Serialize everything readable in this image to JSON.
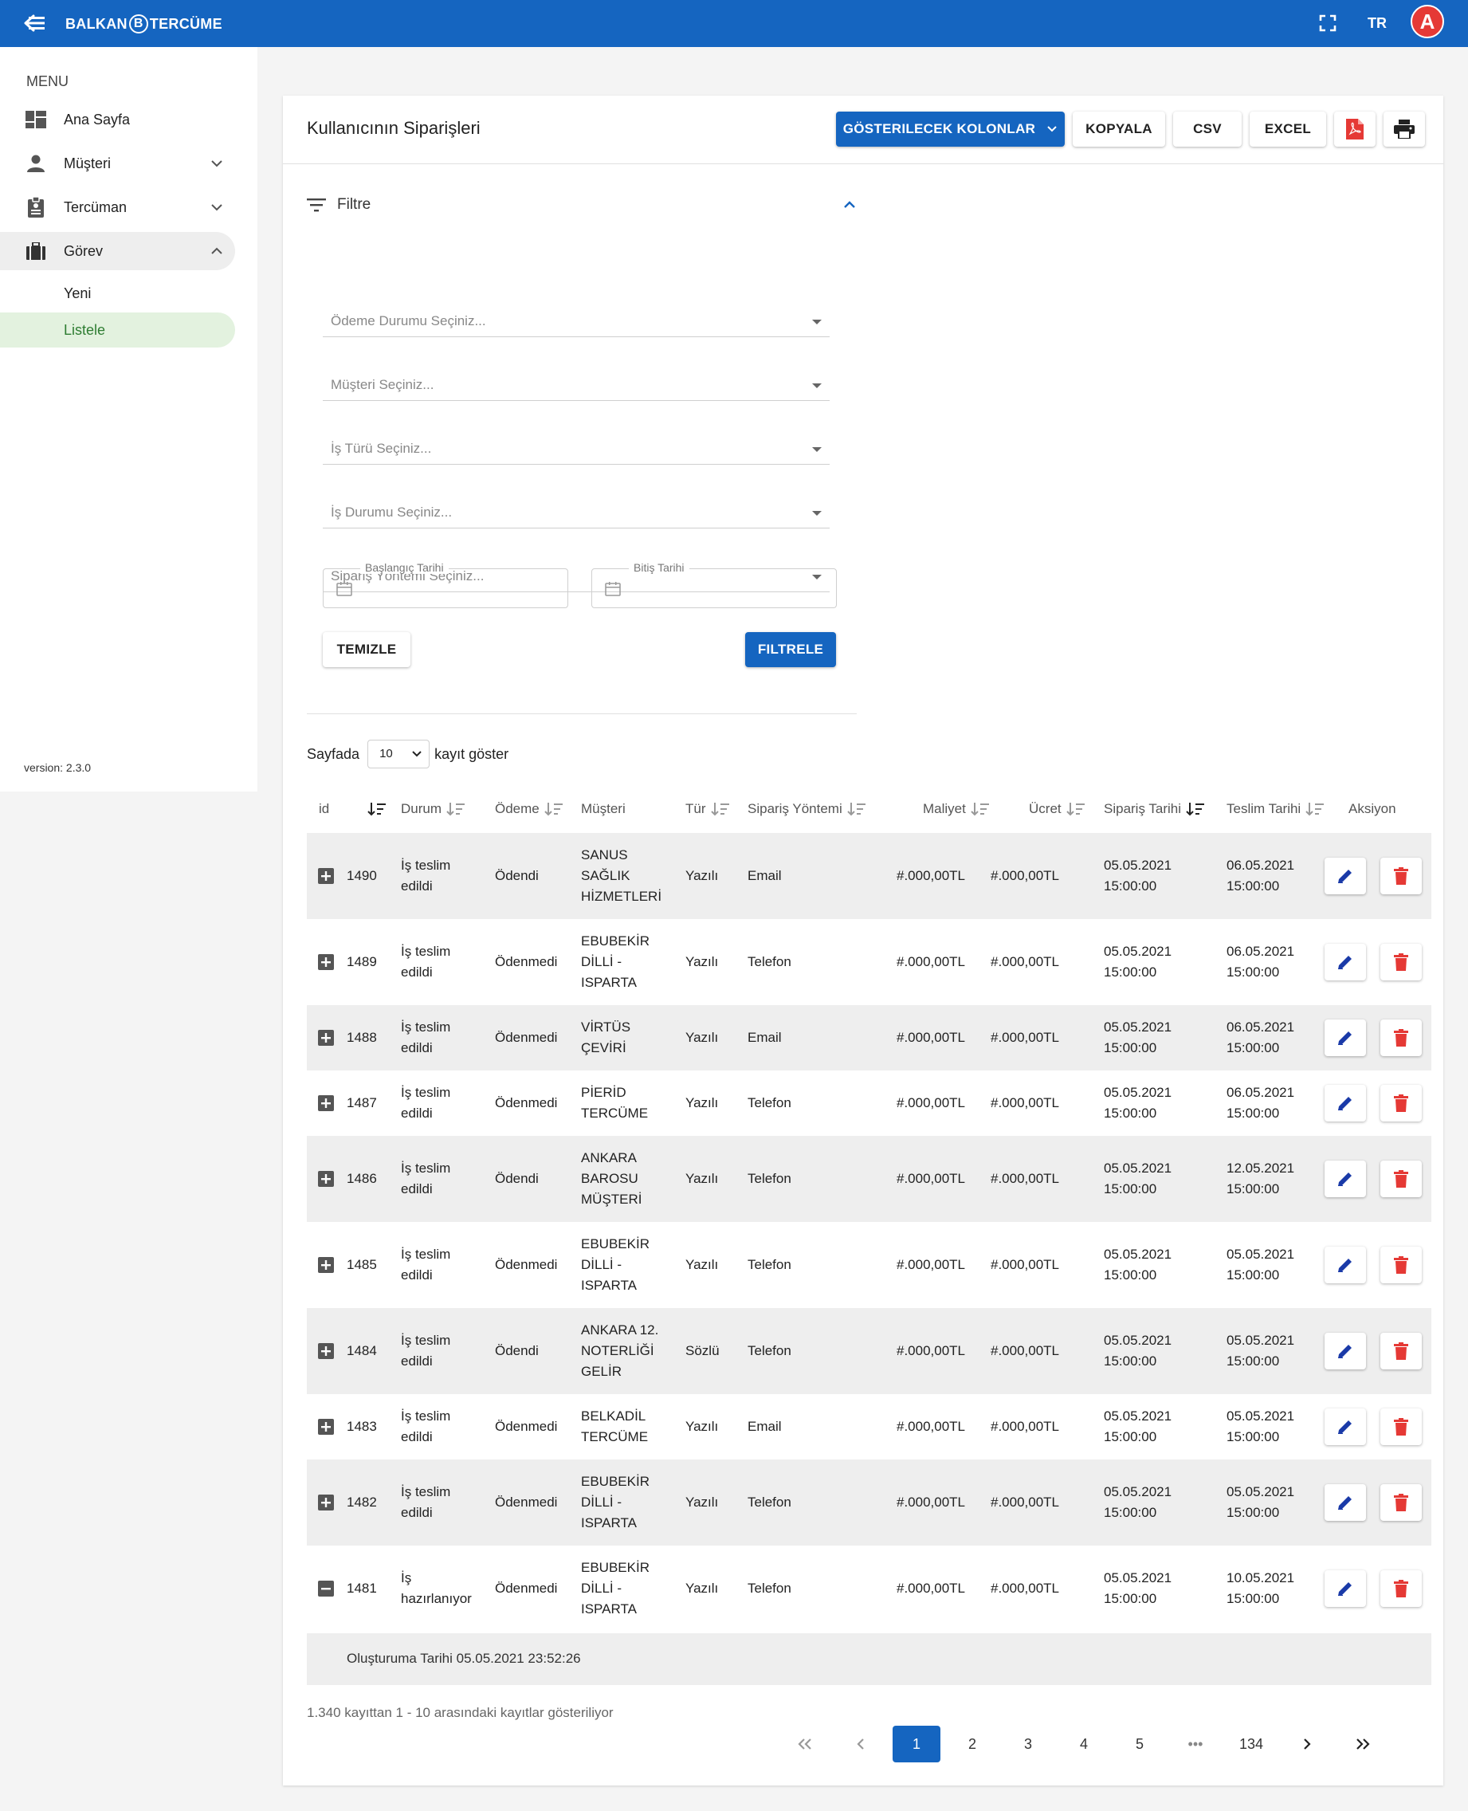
{
  "header": {
    "logo_left": "BALKAN",
    "logo_mid": "B",
    "logo_right": "TERCÜME",
    "lang": "TR",
    "avatar": "A"
  },
  "sidebar": {
    "menu_title": "MENU",
    "items": [
      {
        "label": "Ana Sayfa"
      },
      {
        "label": "Müşteri"
      },
      {
        "label": "Tercüman"
      },
      {
        "label": "Görev"
      }
    ],
    "sub_items": [
      {
        "label": "Yeni"
      },
      {
        "label": "Listele"
      }
    ],
    "version": "version: 2.3.0"
  },
  "card": {
    "title": "Kullanıcının Siparişleri",
    "buttons": {
      "columns": "GÖSTERILECEK KOLONLAR",
      "copy": "KOPYALA",
      "csv": "CSV",
      "excel": "EXCEL"
    }
  },
  "filter": {
    "title": "Filtre",
    "selects": [
      "Ödeme Durumu Seçiniz...",
      "Müşteri Seçiniz...",
      "İş Türü Seçiniz...",
      "İş Durumu Seçiniz...",
      "Sipariş Yöntemi Seçiniz..."
    ],
    "start_date_label": "Başlangıç Tarihi",
    "end_date_label": "Bitiş Tarihi",
    "clear_label": "TEMIZLE",
    "apply_label": "FILTRELE"
  },
  "perpage": {
    "prefix": "Sayfada",
    "value": "10",
    "suffix": "kayıt göster"
  },
  "table": {
    "columns": [
      "id",
      "Durum",
      "Ödeme",
      "Müşteri",
      "Tür",
      "Sipariş Yöntemi",
      "Maliyet",
      "Ücret",
      "Sipariş Tarihi",
      "Teslim Tarihi",
      "Aksiyon"
    ],
    "rows": [
      {
        "id": "1490",
        "status": [
          "İş teslim",
          "edildi"
        ],
        "payment": "Ödendi",
        "customer": [
          "SANUS",
          "SAĞLIK",
          "HİZMETLERİ"
        ],
        "type": "Yazılı",
        "method": "Email",
        "cost": "#.000,00TL",
        "fee": "#.000,00TL",
        "order_date": [
          "05.05.2021",
          "15:00:00"
        ],
        "delivery_date": [
          "06.05.2021",
          "15:00:00"
        ]
      },
      {
        "id": "1489",
        "status": [
          "İş teslim",
          "edildi"
        ],
        "payment": "Ödenmedi",
        "customer": [
          "EBUBEKİR",
          "DİLLİ -",
          "ISPARTA"
        ],
        "type": "Yazılı",
        "method": "Telefon",
        "cost": "#.000,00TL",
        "fee": "#.000,00TL",
        "order_date": [
          "05.05.2021",
          "15:00:00"
        ],
        "delivery_date": [
          "06.05.2021",
          "15:00:00"
        ]
      },
      {
        "id": "1488",
        "status": [
          "İş teslim",
          "edildi"
        ],
        "payment": "Ödenmedi",
        "customer": [
          "VİRTÜS",
          "ÇEVİRİ"
        ],
        "type": "Yazılı",
        "method": "Email",
        "cost": "#.000,00TL",
        "fee": "#.000,00TL",
        "order_date": [
          "05.05.2021",
          "15:00:00"
        ],
        "delivery_date": [
          "06.05.2021",
          "15:00:00"
        ]
      },
      {
        "id": "1487",
        "status": [
          "İş teslim",
          "edildi"
        ],
        "payment": "Ödenmedi",
        "customer": [
          "PİERİD",
          "TERCÜME"
        ],
        "type": "Yazılı",
        "method": "Telefon",
        "cost": "#.000,00TL",
        "fee": "#.000,00TL",
        "order_date": [
          "05.05.2021",
          "15:00:00"
        ],
        "delivery_date": [
          "06.05.2021",
          "15:00:00"
        ]
      },
      {
        "id": "1486",
        "status": [
          "İş teslim",
          "edildi"
        ],
        "payment": "Ödendi",
        "customer": [
          "ANKARA",
          "BAROSU",
          "MÜŞTERİ"
        ],
        "type": "Yazılı",
        "method": "Telefon",
        "cost": "#.000,00TL",
        "fee": "#.000,00TL",
        "order_date": [
          "05.05.2021",
          "15:00:00"
        ],
        "delivery_date": [
          "12.05.2021",
          "15:00:00"
        ]
      },
      {
        "id": "1485",
        "status": [
          "İş teslim",
          "edildi"
        ],
        "payment": "Ödenmedi",
        "customer": [
          "EBUBEKİR",
          "DİLLİ -",
          "ISPARTA"
        ],
        "type": "Yazılı",
        "method": "Telefon",
        "cost": "#.000,00TL",
        "fee": "#.000,00TL",
        "order_date": [
          "05.05.2021",
          "15:00:00"
        ],
        "delivery_date": [
          "05.05.2021",
          "15:00:00"
        ]
      },
      {
        "id": "1484",
        "status": [
          "İş teslim",
          "edildi"
        ],
        "payment": "Ödendi",
        "customer": [
          "ANKARA 12.",
          "NOTERLİĞİ",
          "GELİR"
        ],
        "type": "Sözlü",
        "method": "Telefon",
        "cost": "#.000,00TL",
        "fee": "#.000,00TL",
        "order_date": [
          "05.05.2021",
          "15:00:00"
        ],
        "delivery_date": [
          "05.05.2021",
          "15:00:00"
        ]
      },
      {
        "id": "1483",
        "status": [
          "İş teslim",
          "edildi"
        ],
        "payment": "Ödenmedi",
        "customer": [
          "BELKADİL",
          "TERCÜME"
        ],
        "type": "Yazılı",
        "method": "Email",
        "cost": "#.000,00TL",
        "fee": "#.000,00TL",
        "order_date": [
          "05.05.2021",
          "15:00:00"
        ],
        "delivery_date": [
          "05.05.2021",
          "15:00:00"
        ]
      },
      {
        "id": "1482",
        "status": [
          "İş teslim",
          "edildi"
        ],
        "payment": "Ödenmedi",
        "customer": [
          "EBUBEKİR",
          "DİLLİ -",
          "ISPARTA"
        ],
        "type": "Yazılı",
        "method": "Telefon",
        "cost": "#.000,00TL",
        "fee": "#.000,00TL",
        "order_date": [
          "05.05.2021",
          "15:00:00"
        ],
        "delivery_date": [
          "05.05.2021",
          "15:00:00"
        ]
      },
      {
        "id": "1481",
        "status": [
          "İş",
          "hazırlanıyor"
        ],
        "payment": "Ödenmedi",
        "customer": [
          "EBUBEKİR",
          "DİLLİ -",
          "ISPARTA"
        ],
        "type": "Yazılı",
        "method": "Telefon",
        "cost": "#.000,00TL",
        "fee": "#.000,00TL",
        "order_date": [
          "05.05.2021",
          "15:00:00"
        ],
        "delivery_date": [
          "10.05.2021",
          "15:00:00"
        ],
        "expanded": true
      }
    ],
    "detail_text": "Oluşturuma Tarihi 05.05.2021 23:52:26"
  },
  "footer": {
    "info": "1.340 kayıttan 1 - 10 arasındaki kayıtlar gösteriliyor",
    "pages": [
      "1",
      "2",
      "3",
      "4",
      "5",
      "•••",
      "134"
    ],
    "active_page": "1"
  },
  "colors": {
    "primary": "#1565c0",
    "danger": "#e53935",
    "edit": "#1a3aa8",
    "active_nav_bg": "#e3f2df",
    "active_nav_text": "#2e7d32"
  }
}
